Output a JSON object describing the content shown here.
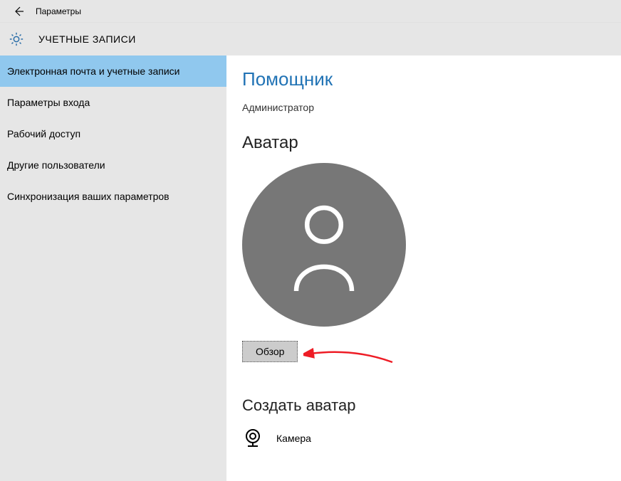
{
  "titlebar": {
    "title": "Параметры"
  },
  "header": {
    "title": "УЧЕТНЫЕ ЗАПИСИ"
  },
  "sidebar": {
    "items": [
      {
        "label": "Электронная почта и учетные записи",
        "selected": true
      },
      {
        "label": "Параметры входа",
        "selected": false
      },
      {
        "label": "Рабочий доступ",
        "selected": false
      },
      {
        "label": "Другие пользователи",
        "selected": false
      },
      {
        "label": "Синхронизация ваших параметров",
        "selected": false
      }
    ]
  },
  "main": {
    "user_name": "Помощник",
    "role": "Администратор",
    "avatar_title": "Аватар",
    "browse_label": "Обзор",
    "create_title": "Создать аватар",
    "camera_label": "Камера"
  }
}
